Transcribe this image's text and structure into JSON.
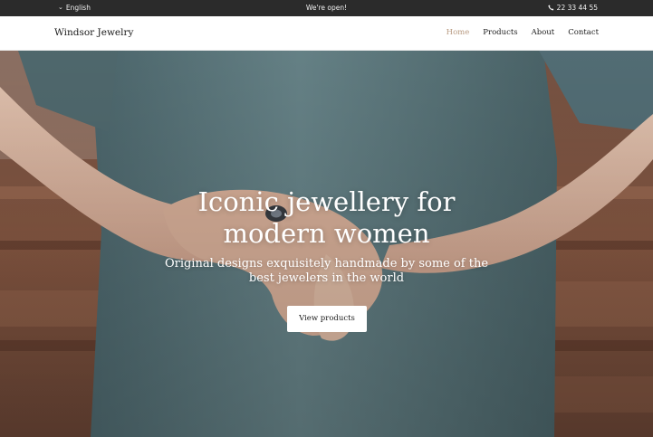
{
  "topbar": {
    "language": "English",
    "status": "We're open!",
    "phone": "22 33 44 55"
  },
  "navbar": {
    "brand": "Windsor Jewelry",
    "links": [
      {
        "label": "Home",
        "active": true
      },
      {
        "label": "Products",
        "active": false
      },
      {
        "label": "About",
        "active": false
      },
      {
        "label": "Contact",
        "active": false
      }
    ]
  },
  "hero": {
    "title_line1": "Iconic jewellery for",
    "title_line2": "modern women",
    "subtitle_line1": "Original designs exquisitely handmade by some of the",
    "subtitle_line2": "best jewelers in the world",
    "cta": "View products"
  },
  "colors": {
    "topbar_bg": "#2b2b2b",
    "active_link": "#b89a80",
    "shirt": "#5f7b80"
  }
}
